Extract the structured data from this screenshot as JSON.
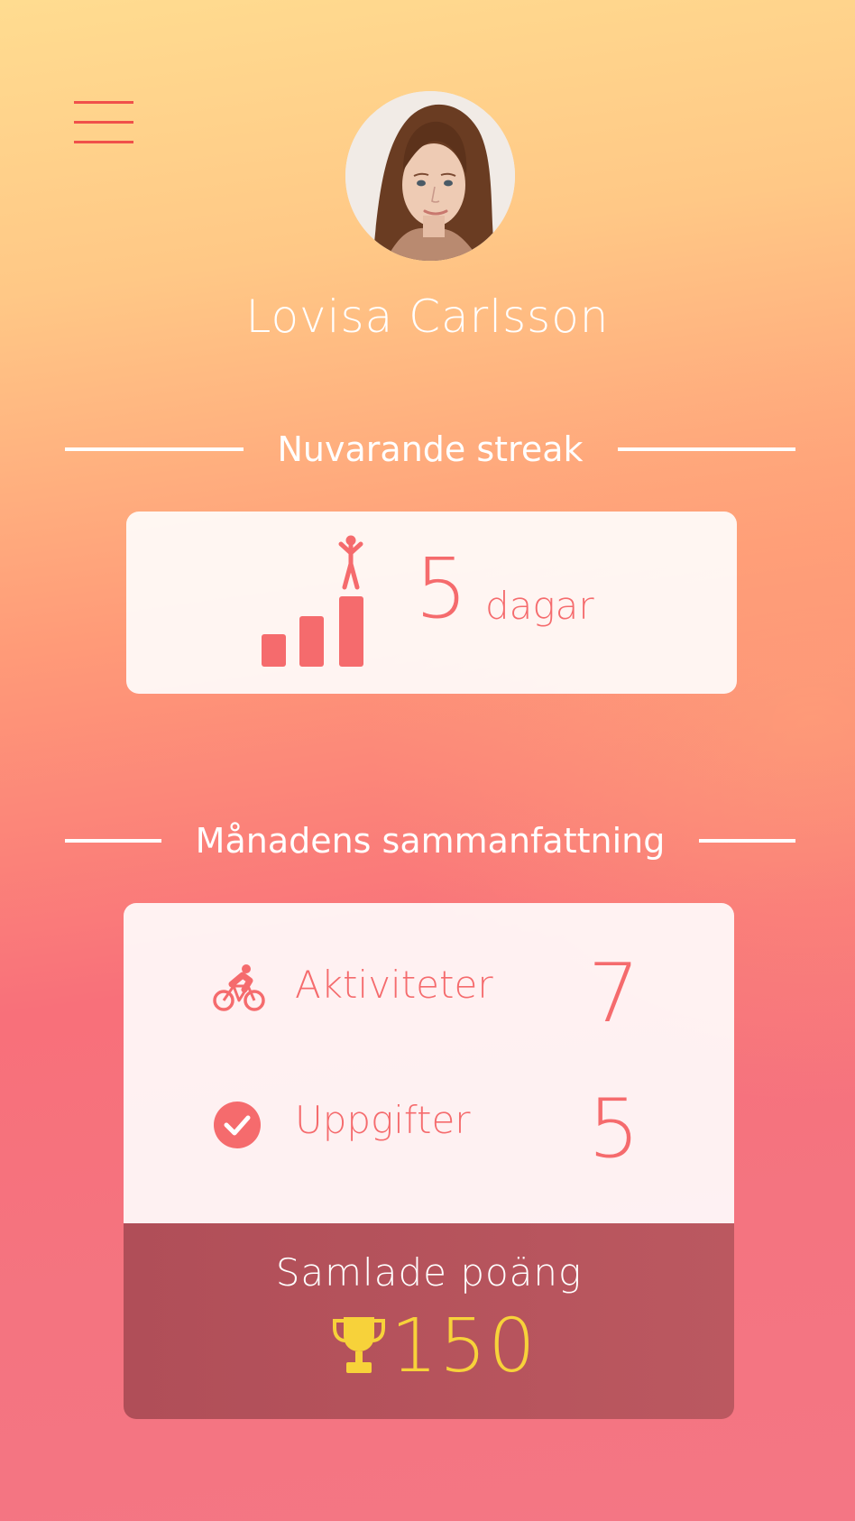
{
  "header": {
    "menu_icon": "hamburger-menu-icon"
  },
  "profile": {
    "name": "Lovisa Carlsson",
    "avatar": "profile-photo"
  },
  "streak": {
    "title": "Nuvarande streak",
    "icon": "streak-bars-icon",
    "value": "5",
    "unit": "dagar"
  },
  "summary": {
    "title": "Månadens sammanfattning",
    "rows": [
      {
        "icon": "bicycle-icon",
        "label": "Aktiviteter",
        "value": "7"
      },
      {
        "icon": "checkmark-circle-icon",
        "label": "Uppgifter",
        "value": "5"
      }
    ],
    "points": {
      "label": "Samlade poäng",
      "icon": "trophy-icon",
      "value": "150"
    }
  },
  "colors": {
    "accent": "#f56b6d",
    "menu": "#f0504a",
    "points_bg": "#b04e58",
    "points_value": "#f7d23a",
    "gradient_top": "#ffdc90",
    "gradient_bottom": "#f47684"
  }
}
